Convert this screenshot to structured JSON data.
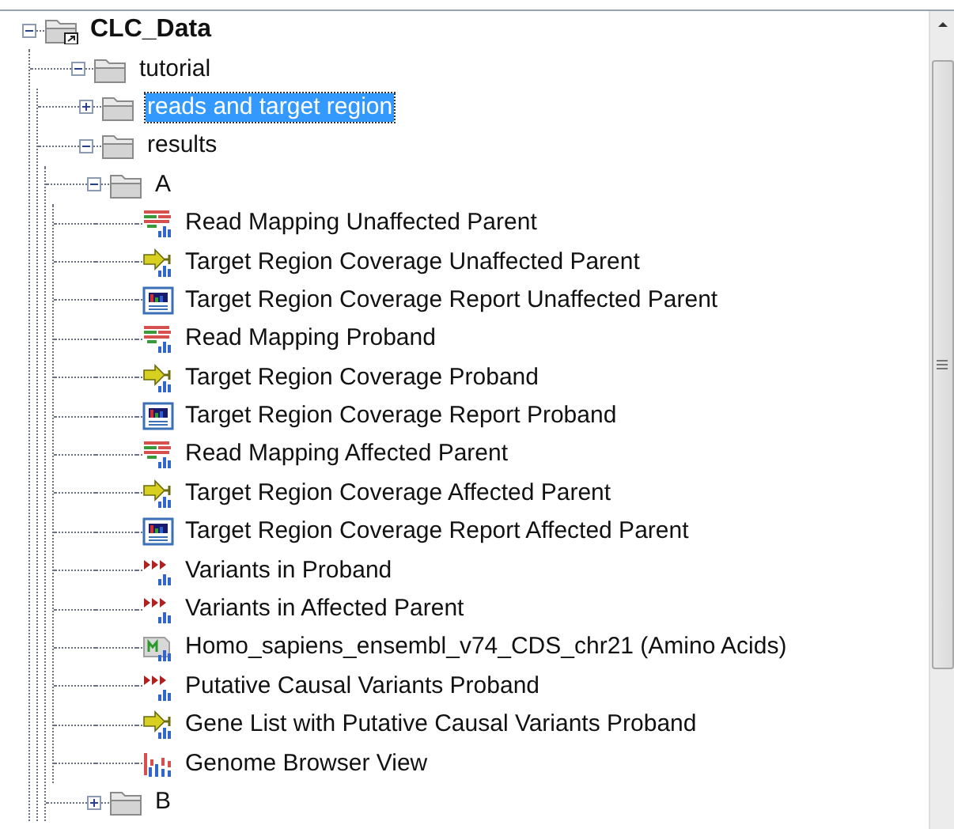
{
  "tree": [
    {
      "label": "CLC_Data",
      "kind": "shortcut-folder",
      "expanded": true,
      "selected": false,
      "children": [
        {
          "label": "tutorial",
          "kind": "folder",
          "expanded": true,
          "selected": false,
          "children": [
            {
              "label": "reads and target region",
              "kind": "folder",
              "expanded": false,
              "selected": true
            },
            {
              "label": "results",
              "kind": "folder",
              "expanded": true,
              "selected": false,
              "children": [
                {
                  "label": "A",
                  "kind": "folder",
                  "expanded": true,
                  "selected": false,
                  "children": [
                    {
                      "label": "Read Mapping Unaffected Parent",
                      "kind": "mapping",
                      "selected": false
                    },
                    {
                      "label": "Target Region Coverage Unaffected Parent",
                      "kind": "track",
                      "selected": false
                    },
                    {
                      "label": "Target Region Coverage Report Unaffected Parent",
                      "kind": "report",
                      "selected": false
                    },
                    {
                      "label": "Read Mapping Proband",
                      "kind": "mapping",
                      "selected": false
                    },
                    {
                      "label": "Target Region Coverage Proband",
                      "kind": "track",
                      "selected": false
                    },
                    {
                      "label": "Target Region Coverage Report Proband",
                      "kind": "report",
                      "selected": false
                    },
                    {
                      "label": "Read Mapping Affected Parent",
                      "kind": "mapping",
                      "selected": false
                    },
                    {
                      "label": "Target Region Coverage Affected Parent",
                      "kind": "track",
                      "selected": false
                    },
                    {
                      "label": "Target Region Coverage Report Affected Parent",
                      "kind": "report",
                      "selected": false
                    },
                    {
                      "label": "Variants in Proband",
                      "kind": "variants",
                      "selected": false
                    },
                    {
                      "label": "Variants in Affected Parent",
                      "kind": "variants",
                      "selected": false
                    },
                    {
                      "label": "Homo_sapiens_ensembl_v74_CDS_chr21 (Amino Acids)",
                      "kind": "protein",
                      "selected": false
                    },
                    {
                      "label": "Putative Causal Variants Proband",
                      "kind": "variants",
                      "selected": false
                    },
                    {
                      "label": "Gene List with Putative Causal Variants Proband",
                      "kind": "track",
                      "selected": false
                    },
                    {
                      "label": "Genome Browser View",
                      "kind": "browser",
                      "selected": false
                    }
                  ]
                },
                {
                  "label": "B",
                  "kind": "folder",
                  "expanded": false,
                  "selected": false
                }
              ]
            }
          ]
        }
      ]
    }
  ]
}
